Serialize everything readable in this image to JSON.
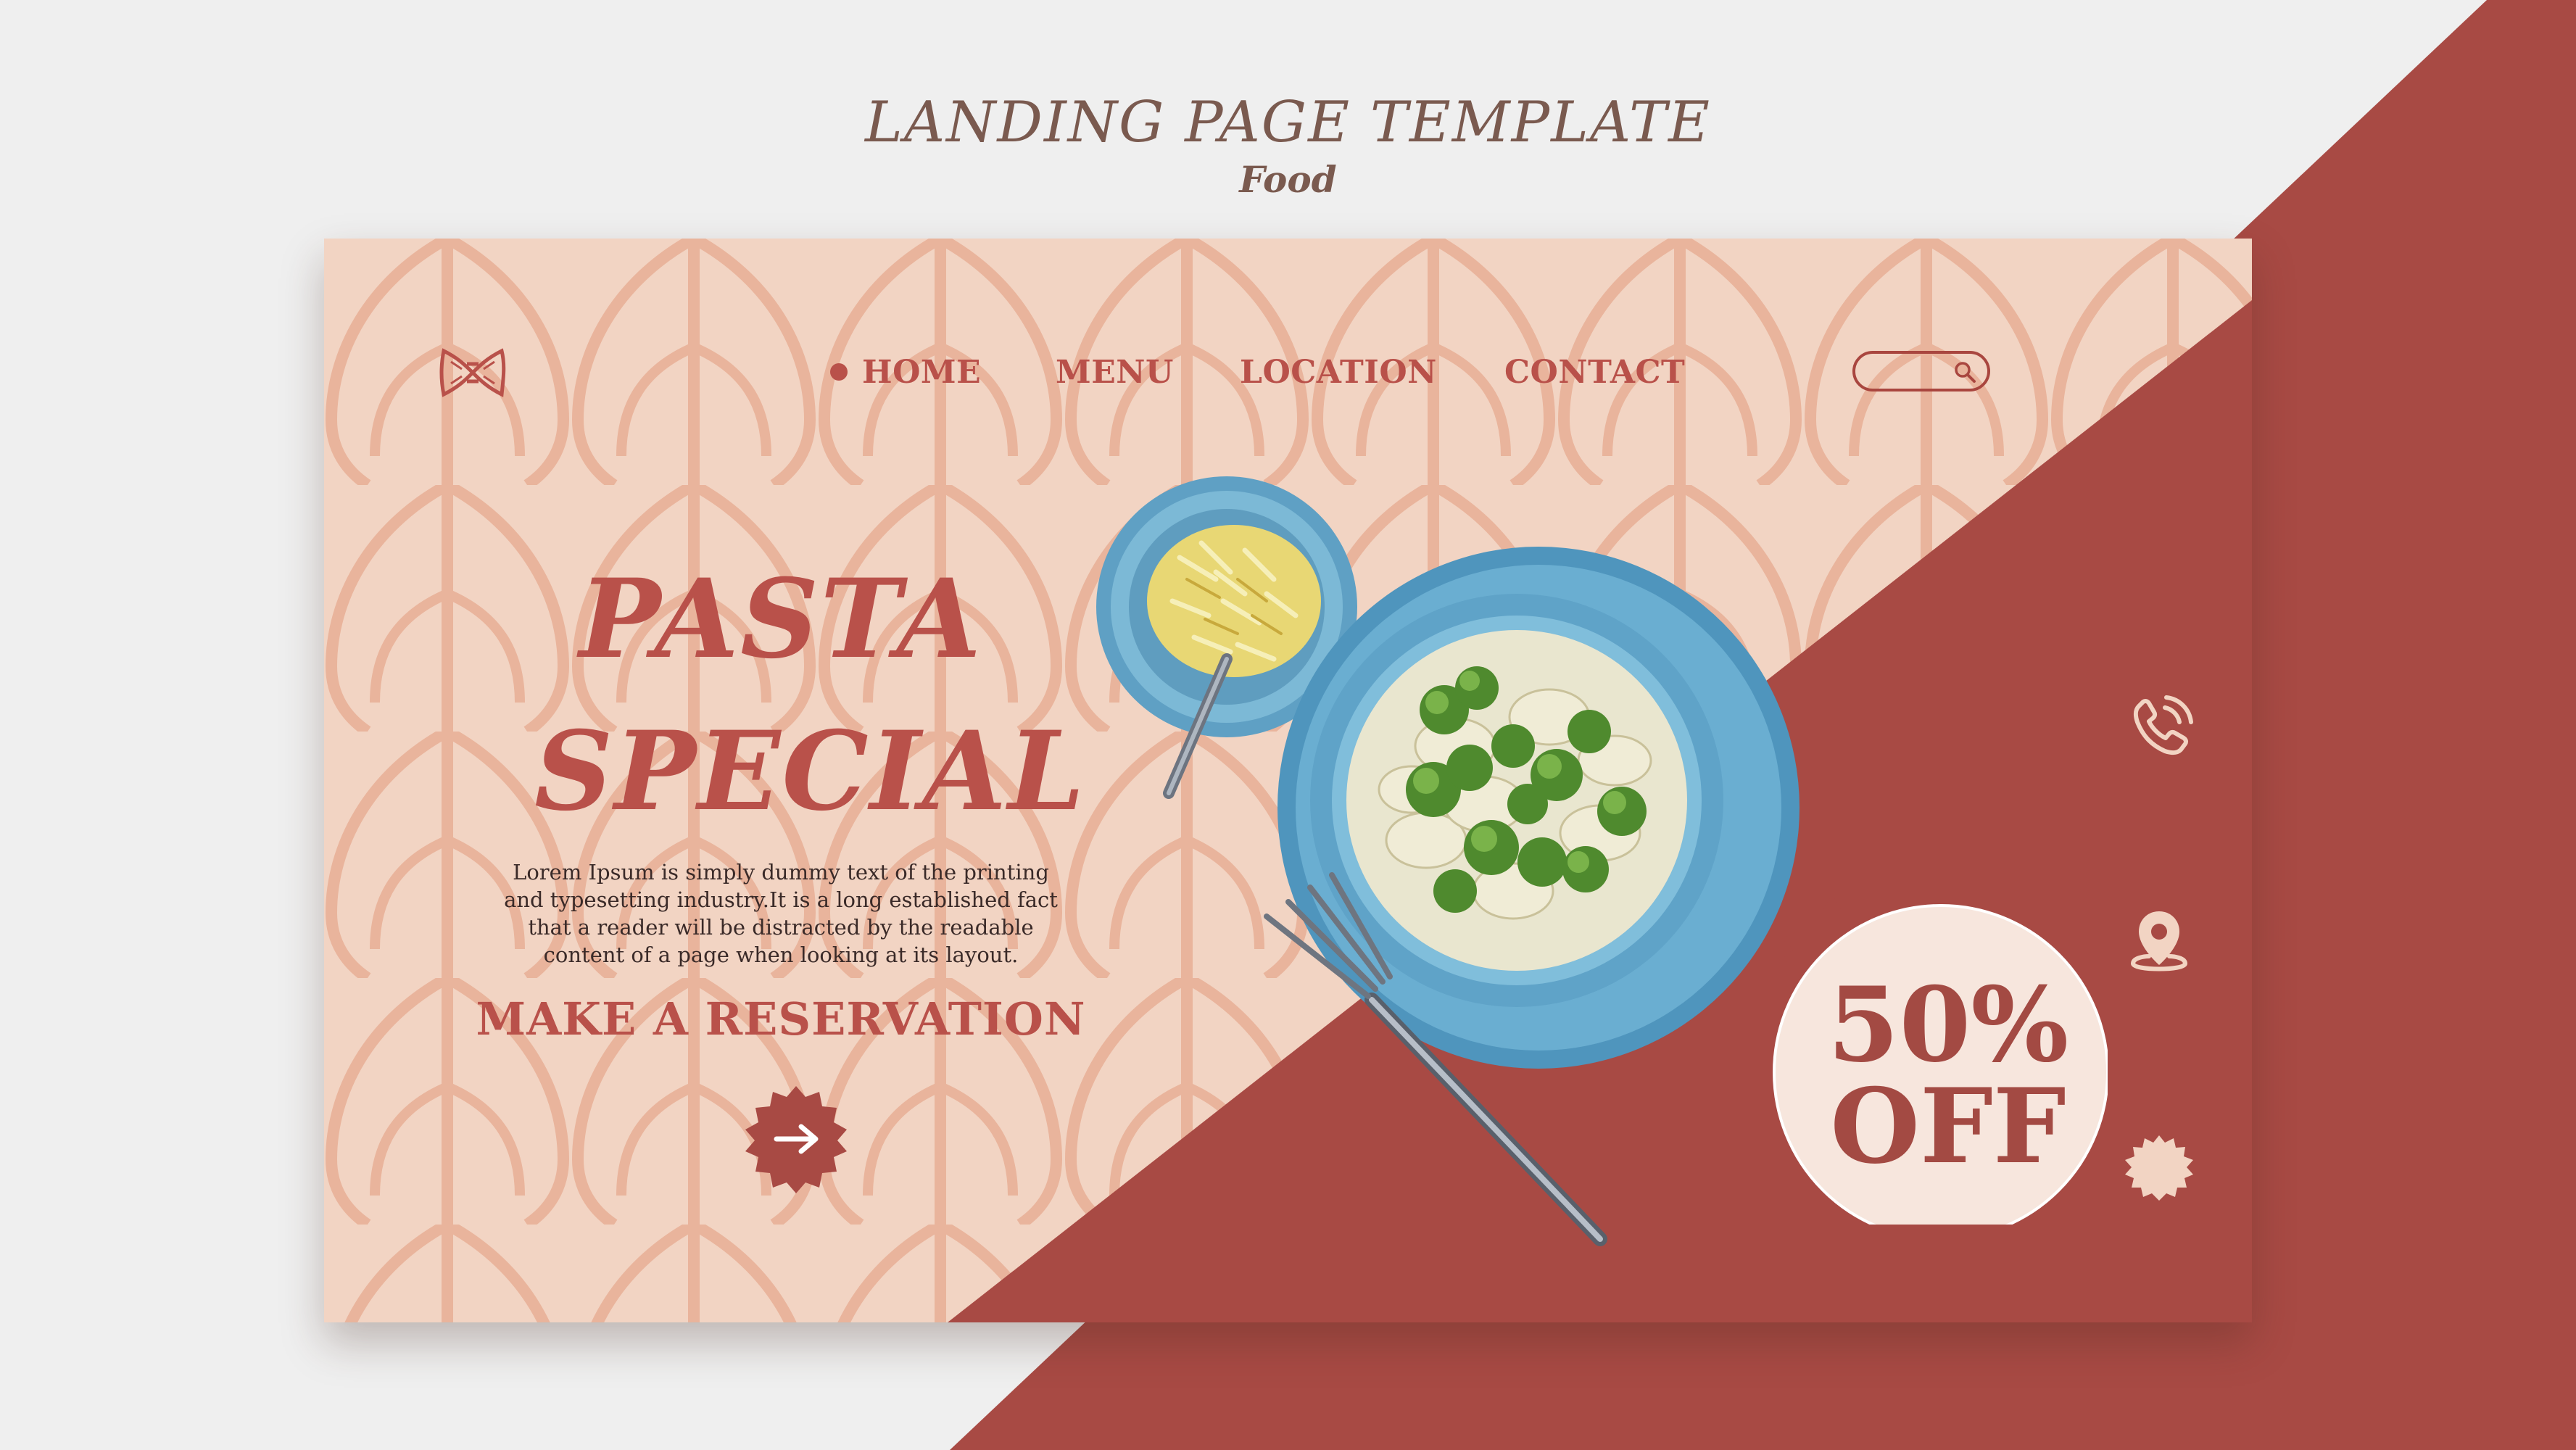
{
  "header": {
    "title": "LANDING PAGE TEMPLATE",
    "subtitle": "Food"
  },
  "nav": {
    "home": "HOME",
    "menu": "MENU",
    "location": "LOCATION",
    "contact": "CONTACT"
  },
  "hero": {
    "title_line1": "PASTA",
    "title_line2": "SPECIAL",
    "description": "Lorem Ipsum is simply dummy text of the printing and typesetting industry.It is a long established fact that a reader will be distracted by the readable content of a page when looking at its layout.",
    "cta": "MAKE A RESERVATION"
  },
  "promo": {
    "line1": "50%",
    "line2": "OFF"
  },
  "icons": {
    "logo": "bow-pasta-logo-icon",
    "search": "search-icon",
    "cta": "arrow-right-icon",
    "phone": "phone-icon",
    "location": "location-pin-icon",
    "badge": "starburst-badge-icon"
  },
  "colors": {
    "brand": "#b9514a",
    "panel": "#a84a44",
    "card_bg": "#f2d4c3",
    "pattern": "#e9b49c",
    "page_bg": "#efefef",
    "promo_bg": "#f7e6dd"
  }
}
